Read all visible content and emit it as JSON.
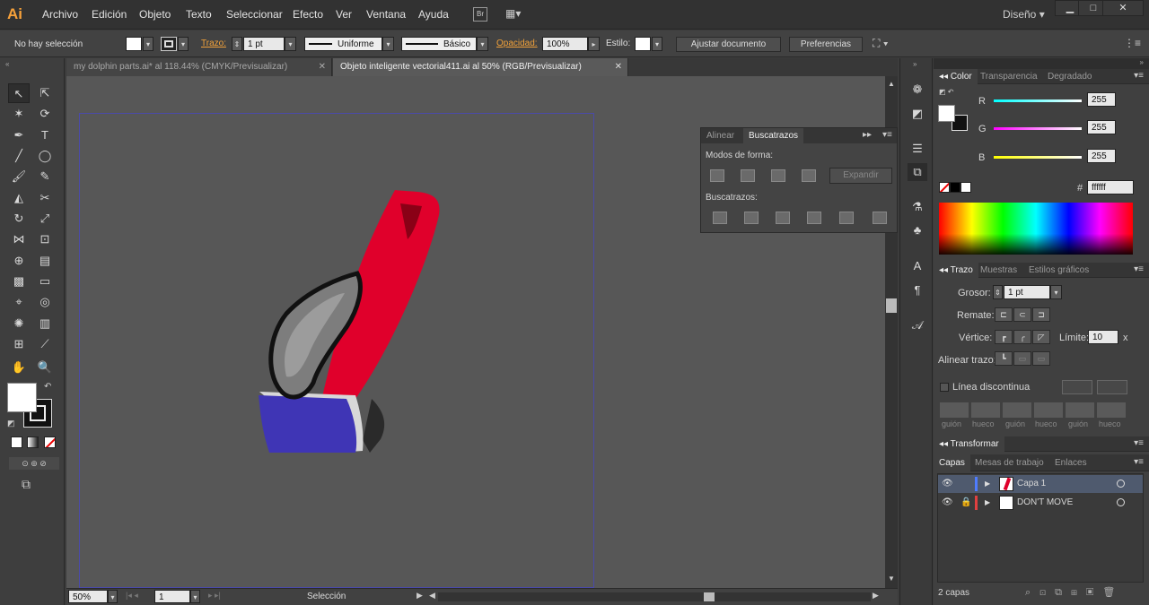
{
  "menu": {
    "logo": "Ai",
    "items": [
      "Archivo",
      "Edición",
      "Objeto",
      "Texto",
      "Seleccionar",
      "Efecto",
      "Ver",
      "Ventana",
      "Ayuda"
    ],
    "br_badge": "Br",
    "workspace": "Diseño"
  },
  "control": {
    "selection": "No hay selección",
    "stroke_label": "Trazo:",
    "stroke_value": "1 pt",
    "profile": "Uniforme",
    "brush": "Básico",
    "opacity_label": "Opacidad:",
    "opacity_value": "100%",
    "style_label": "Estilo:",
    "btn_adjust": "Ajustar documento",
    "btn_prefs": "Preferencias"
  },
  "tabs": [
    {
      "label": "my dolphin parts.ai* al 118.44% (CMYK/Previsualizar)"
    },
    {
      "label": "Objeto inteligente vectorial411.ai al 50% (RGB/Previsualizar)"
    }
  ],
  "status": {
    "zoom": "50%",
    "page": "1",
    "tool": "Selección"
  },
  "pathfinder": {
    "tab_align": "Alinear",
    "tab_pathfinder": "Buscatrazos",
    "shape_modes": "Modos de forma:",
    "expand": "Expandir",
    "pathfinders": "Buscatrazos:"
  },
  "color_panel": {
    "tabs": [
      "Color",
      "Transparencia",
      "Degradado"
    ],
    "r_label": "R",
    "r_value": "255",
    "g_label": "G",
    "g_value": "255",
    "b_label": "B",
    "b_value": "255",
    "hex_label": "#",
    "hex_value": "ffffff"
  },
  "stroke_panel": {
    "tabs": [
      "Trazo",
      "Muestras",
      "Estilos gráficos"
    ],
    "weight_label": "Grosor:",
    "weight_value": "1 pt",
    "cap_label": "Remate:",
    "corner_label": "Vértice:",
    "limit_label": "Límite:",
    "limit_value": "10",
    "limit_unit": "x",
    "align_label": "Alinear trazo:",
    "dashed_label": "Línea discontinua",
    "dash_labels": [
      "guión",
      "hueco",
      "guión",
      "hueco",
      "guión",
      "hueco"
    ]
  },
  "transform_panel": {
    "title": "Transformar"
  },
  "layers_panel": {
    "tabs": [
      "Capas",
      "Mesas de trabajo",
      "Enlaces"
    ],
    "layers": [
      {
        "name": "Capa 1",
        "color": "#4f7cff"
      },
      {
        "name": "DON'T MOVE",
        "color": "#e04040"
      }
    ],
    "footer": "2 capas"
  },
  "colors": {
    "accent_orange": "#f7a13a",
    "feather_red": "#e0002b",
    "book_blue": "#3f35b5"
  }
}
